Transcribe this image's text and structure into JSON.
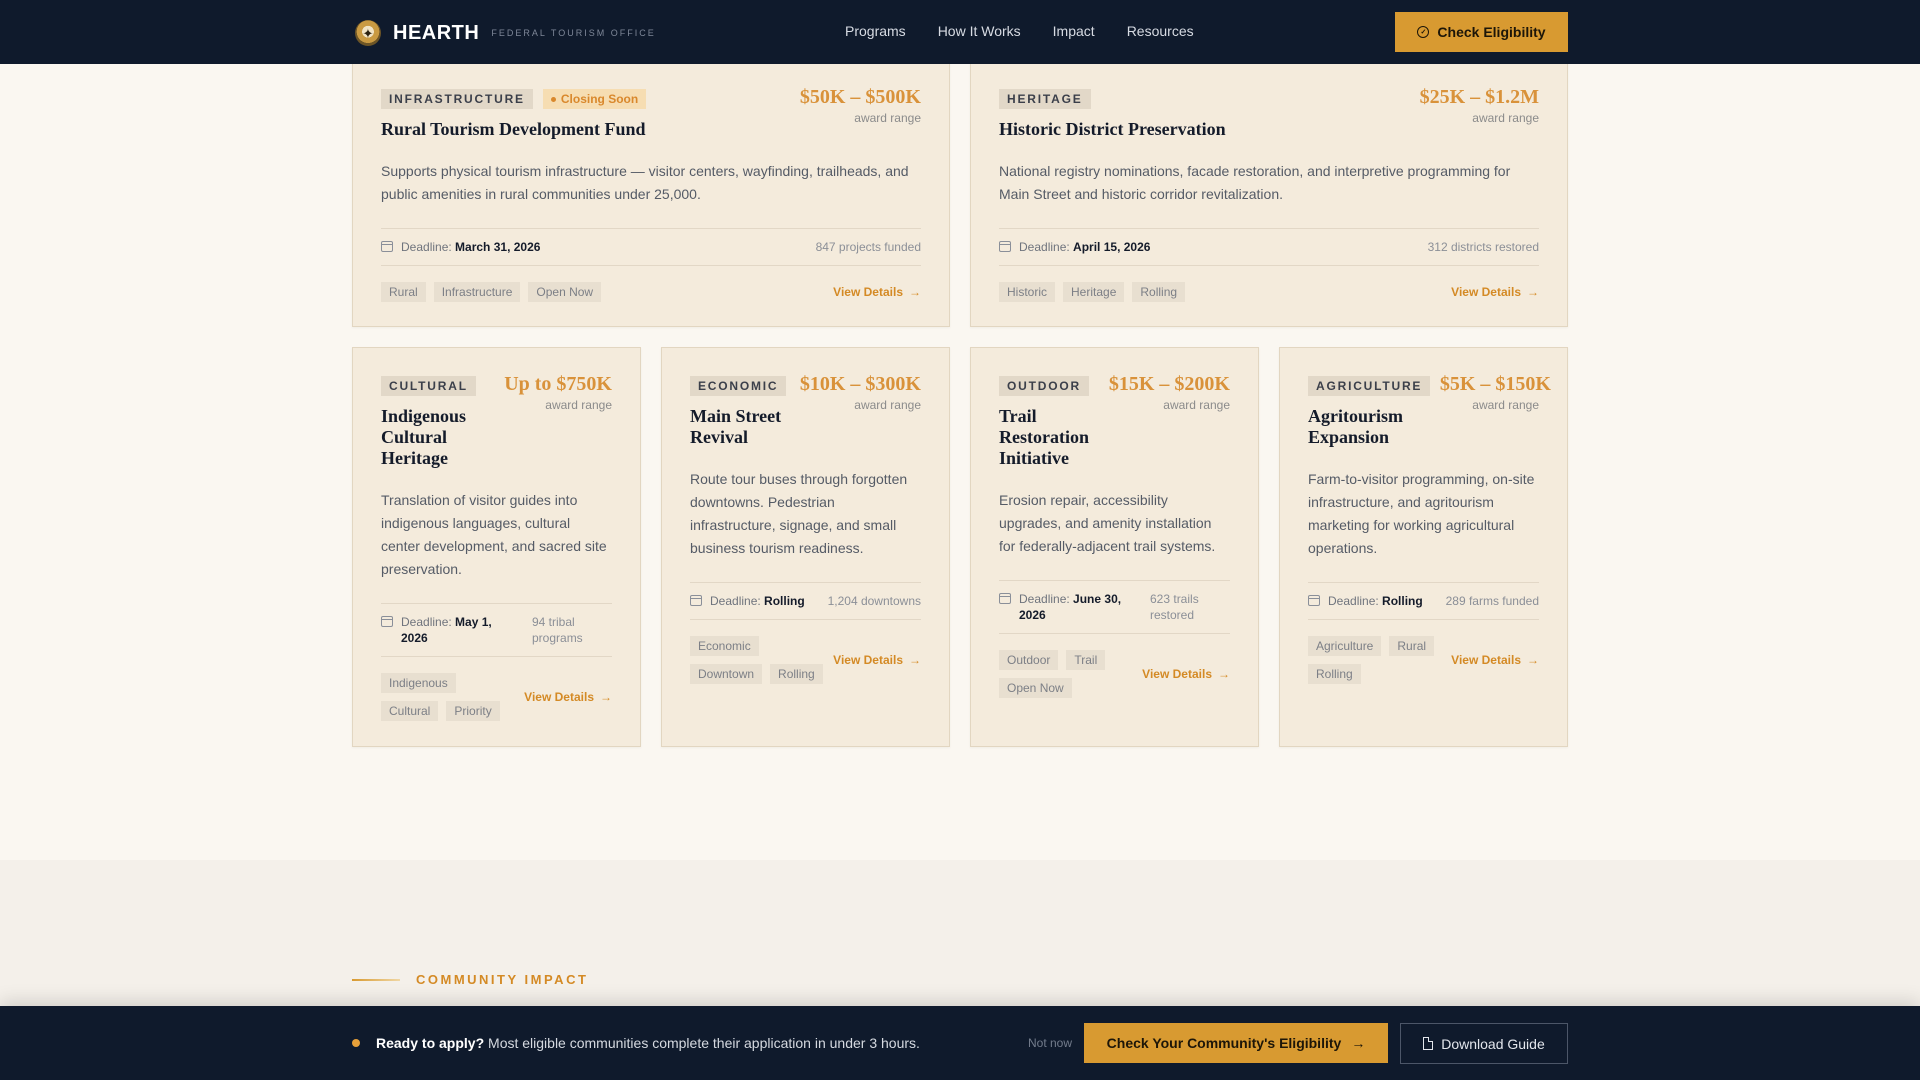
{
  "nav": {
    "brand_seal_glyph": "✦",
    "brand_name": "HEARTH",
    "brand_subtitle": "FEDERAL TOURISM OFFICE",
    "links": [
      "Programs",
      "How It Works",
      "Impact",
      "Resources"
    ],
    "cta_label": "Check Eligibility",
    "cta_icon": "check-circle-icon",
    "cta_icon_glyph": "✓"
  },
  "colors": {
    "navy": "#0f1a2c",
    "accent": "#d89a31",
    "card_bg": "#f4ebdc",
    "amount": "#d9923a"
  },
  "cards": [
    {
      "category": "INFRASTRUCTURE",
      "status": "Closing Soon",
      "title": "Rural Tourism Development Fund",
      "amount": "$50K – $500K",
      "amount_unit": "award range",
      "description": "Supports physical tourism infrastructure — visitor centers, wayfinding, trailheads, and public amenities in rural communities under 25,000.",
      "deadline_label": "Deadline:",
      "deadline": "March 31, 2026",
      "funded": "847 projects funded",
      "tags": [
        "Rural",
        "Infrastructure",
        "Open Now"
      ],
      "action": "View Details"
    },
    {
      "category": "HERITAGE",
      "title": "Historic District Preservation",
      "amount": "$25K – $1.2M",
      "amount_unit": "award range",
      "description": "National registry nominations, facade restoration, and interpretive programming for Main Street and historic corridor revitalization.",
      "deadline_label": "Deadline:",
      "deadline": "April 15, 2026",
      "funded": "312 districts restored",
      "tags": [
        "Historic",
        "Heritage",
        "Rolling"
      ],
      "action": "View Details"
    },
    {
      "category": "CULTURAL",
      "title": "Indigenous Cultural Heritage",
      "amount": "Up to $750K",
      "amount_unit": "award range",
      "description": "Translation of visitor guides into indigenous languages, cultural center development, and sacred site preservation.",
      "deadline_label": "Deadline:",
      "deadline": "May 1, 2026",
      "funded": "94 tribal programs",
      "tags": [
        "Indigenous",
        "Cultural",
        "Priority"
      ],
      "action": "View Details"
    },
    {
      "category": "ECONOMIC",
      "title": "Main Street Revival",
      "amount": "$10K – $300K",
      "amount_unit": "award range",
      "description": "Route tour buses through forgotten downtowns. Pedestrian infrastructure, signage, and small business tourism readiness.",
      "deadline_label": "Deadline:",
      "deadline": "Rolling",
      "funded": "1,204 downtowns",
      "tags": [
        "Economic",
        "Downtown",
        "Rolling"
      ],
      "action": "View Details"
    },
    {
      "category": "OUTDOOR",
      "title": "Trail Restoration Initiative",
      "amount": "$15K – $200K",
      "amount_unit": "award range",
      "description": "Erosion repair, accessibility upgrades, and amenity installation for federally-adjacent trail systems.",
      "deadline_label": "Deadline:",
      "deadline": "June 30, 2026",
      "funded": "623 trails restored",
      "tags": [
        "Outdoor",
        "Trail",
        "Open Now"
      ],
      "action": "View Details"
    },
    {
      "category": "AGRICULTURE",
      "title": "Agritourism Expansion",
      "amount": "$5K – $150K",
      "amount_unit": "award range",
      "description": "Farm-to-visitor programming, on-site infrastructure, and agritourism marketing for working agricultural operations.",
      "deadline_label": "Deadline:",
      "deadline": "Rolling",
      "funded": "289 farms funded",
      "tags": [
        "Agriculture",
        "Rural",
        "Rolling"
      ],
      "action": "View Details"
    }
  ],
  "view_arrow": "→",
  "impact": {
    "label": "COMMUNITY IMPACT"
  },
  "bottombar": {
    "lead": "Ready to apply?",
    "text": " Most eligible communities complete their application in under 3 hours.",
    "dismiss": "Not now",
    "primary": "Check Your Community's Eligibility",
    "primary_arrow": "→",
    "secondary": "Download Guide",
    "secondary_icon": "document-icon"
  }
}
